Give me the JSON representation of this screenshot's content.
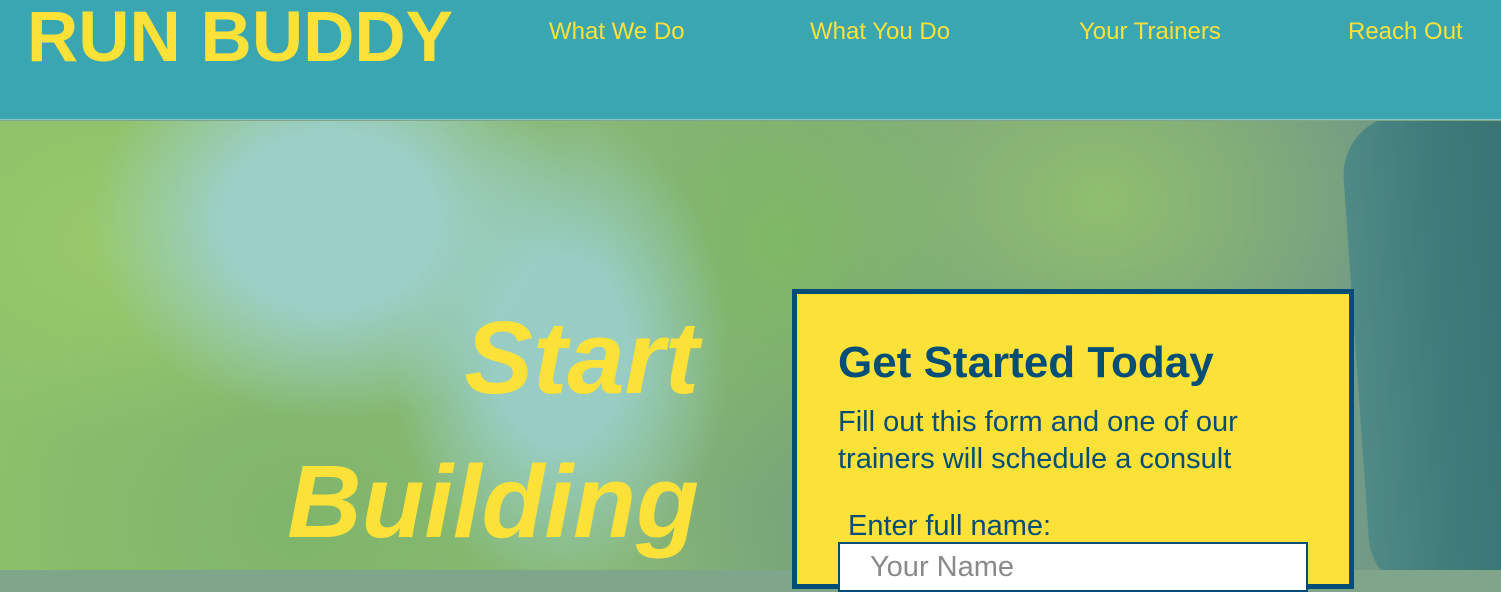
{
  "header": {
    "logo": "RUN BUDDY",
    "nav": [
      "What We Do",
      "What You Do",
      "Your Trainers",
      "Reach Out"
    ]
  },
  "hero": {
    "headline_line1": "Start",
    "headline_line2": "Building"
  },
  "form": {
    "title": "Get Started Today",
    "description": "Fill out this form and one of our trainers will schedule a consult",
    "name_label": "Enter full name:",
    "name_placeholder": "Your Name"
  },
  "colors": {
    "header_bg": "#39a6b2",
    "accent_yellow": "#fce138",
    "dark_blue": "#024e76"
  }
}
